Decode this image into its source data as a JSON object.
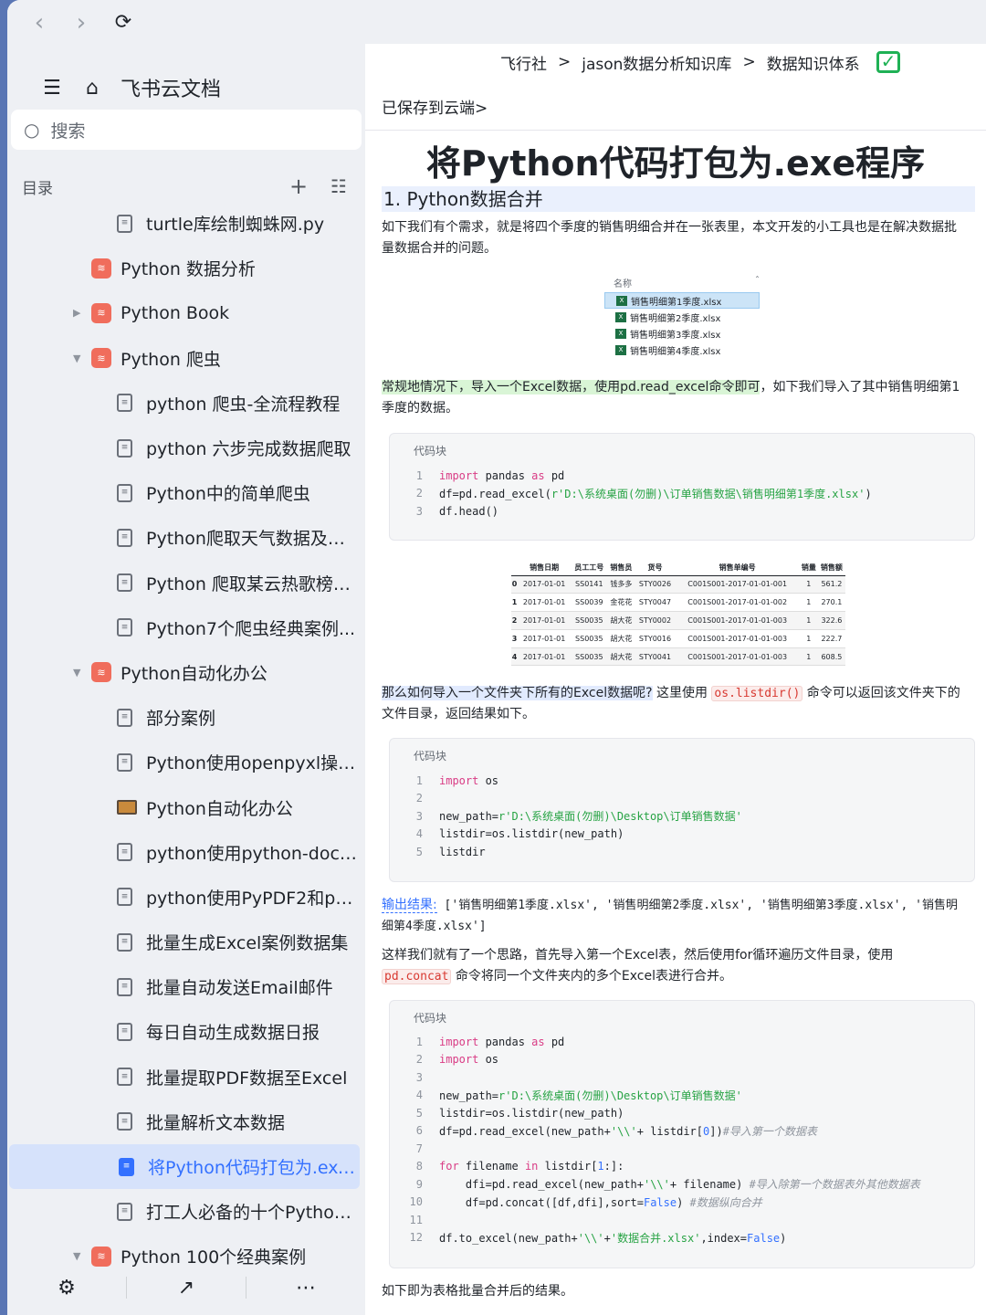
{
  "browser": {
    "back": "‹",
    "forward": "›",
    "reload": "⟳"
  },
  "sidebar": {
    "app_name": "飞书云文档",
    "search_placeholder": "搜索",
    "toc_label": "目录",
    "items": [
      {
        "label": "turtle库绘制蜘蛛网.py",
        "level": 2,
        "icon": "file-icon"
      },
      {
        "label": "Python 数据分析",
        "level": 1,
        "icon": "book-icon"
      },
      {
        "label": "Python Book",
        "level": 1,
        "icon": "book-icon",
        "arrow": "▶"
      },
      {
        "label": "Python 爬虫",
        "level": 1,
        "icon": "book-icon",
        "arrow": "▼"
      },
      {
        "label": "python 爬虫-全流程教程",
        "level": 2,
        "icon": "doc-icon"
      },
      {
        "label": "python 六步完成数据爬取",
        "level": 2,
        "icon": "doc-icon"
      },
      {
        "label": "Python中的简单爬虫",
        "level": 2,
        "icon": "doc-icon"
      },
      {
        "label": "Python爬取天气数据及可...",
        "level": 2,
        "icon": "doc-icon"
      },
      {
        "label": "Python 爬取某云热歌榜歌...",
        "level": 2,
        "icon": "doc-icon"
      },
      {
        "label": "Python7个爬虫经典案例...",
        "level": 2,
        "icon": "doc-icon"
      },
      {
        "label": "Python自动化办公",
        "level": 1,
        "icon": "book-icon",
        "arrow": "▼"
      },
      {
        "label": "部分案例",
        "level": 2,
        "icon": "doc-icon"
      },
      {
        "label": "Python使用openpyxl操作...",
        "level": 2,
        "icon": "doc-icon"
      },
      {
        "label": "Python自动化办公",
        "level": 2,
        "icon": "image-icon"
      },
      {
        "label": "python使用python-docx...",
        "level": 2,
        "icon": "doc-icon"
      },
      {
        "label": "python使用PyPDF2和pdfp...",
        "level": 2,
        "icon": "doc-icon"
      },
      {
        "label": "批量生成Excel案例数据集",
        "level": 2,
        "icon": "doc-icon"
      },
      {
        "label": "批量自动发送Email邮件",
        "level": 2,
        "icon": "doc-icon"
      },
      {
        "label": "每日自动生成数据日报",
        "level": 2,
        "icon": "doc-icon"
      },
      {
        "label": "批量提取PDF数据至Excel",
        "level": 2,
        "icon": "doc-icon"
      },
      {
        "label": "批量解析文本数据",
        "level": 2,
        "icon": "doc-icon"
      },
      {
        "label": "将Python代码打包为.exe...",
        "level": 2,
        "icon": "doc-icon",
        "active": true
      },
      {
        "label": "打工人必备的十个Python...",
        "level": 2,
        "icon": "doc-icon"
      },
      {
        "label": "Python 100个经典案例",
        "level": 1,
        "icon": "book-icon",
        "arrow": "▼"
      }
    ]
  },
  "breadcrumb": {
    "c1": "飞行社",
    "c2": "jason数据分析知识库",
    "c3": "数据知识体系",
    "sep": ">"
  },
  "doc": {
    "saved": "已保存到云端>",
    "title": "将Python代码打包为.exe程序",
    "h1": "1. Python数据合并",
    "p1": "如下我们有个需求，就是将四个季度的销售明细合并在一张表里，本文开发的小工具也是在解决数据批量数据合并的问题。",
    "files_header": "名称",
    "files": [
      "销售明细第1季度.xlsx",
      "销售明细第2季度.xlsx",
      "销售明细第3季度.xlsx",
      "销售明细第4季度.xlsx"
    ],
    "p2_hl": "常规地情况下，导入一个Excel数据，使用pd.read_excel命令即可",
    "p2_rest": "，如下我们导入了其中销售明细第1季度的数据。",
    "code_label": "代码块",
    "p3_hl": "那么如何导入一个文件夹下所有的Excel数据呢?",
    "p3_a": " 这里使用 ",
    "p3_code": "os.listdir()",
    "p3_b": " 命令可以返回该文件夹下的文件目录，返回结果如下。",
    "out_label": "输出结果:",
    "out_text": " ['销售明细第1季度.xlsx', '销售明细第2季度.xlsx', '销售明细第3季度.xlsx', '销售明细第4季度.xlsx']",
    "p4_a": "这样我们就有了一个思路，首先导入第一个Excel表，然后使用for循环遍历文件目录，使用",
    "p4_code": "pd.concat",
    "p4_b": " 命令将同一个文件夹内的多个Excel表进行合并。",
    "p5": "如下即为表格批量合并后的结果。"
  },
  "code1": [
    {
      "n": "1",
      "html": "<span class='kw'>import</span> pandas <span class='kw'>as</span> pd"
    },
    {
      "n": "2",
      "html": "df=pd.read_excel(<span class='st'>r'D:\\系统桌面(勿删)\\订单销售数据\\销售明细第1季度.xlsx'</span>)"
    },
    {
      "n": "3",
      "html": "df.head()"
    }
  ],
  "code2": [
    {
      "n": "1",
      "html": "<span class='kw'>import</span> os"
    },
    {
      "n": "2",
      "html": ""
    },
    {
      "n": "3",
      "html": "new_path=<span class='st'>r'D:\\系统桌面(勿删)\\Desktop\\订单销售数据'</span>"
    },
    {
      "n": "4",
      "html": "listdir=os.listdir(new_path)"
    },
    {
      "n": "5",
      "html": "listdir"
    }
  ],
  "code3": [
    {
      "n": "1",
      "html": "<span class='kw'>import</span> pandas <span class='kw'>as</span> pd"
    },
    {
      "n": "2",
      "html": "<span class='kw'>import</span> os"
    },
    {
      "n": "3",
      "html": ""
    },
    {
      "n": "4",
      "html": "new_path=<span class='st'>r'D:\\系统桌面(勿删)\\Desktop\\订单销售数据'</span>"
    },
    {
      "n": "5",
      "html": "listdir=os.listdir(new_path)"
    },
    {
      "n": "6",
      "html": "df=pd.read_excel(new_path+<span class='st'>'\\\\'</span>+ listdir[<span class='fl'>0</span>])<span class='cm'>#导入第一个数据表</span>"
    },
    {
      "n": "7",
      "html": ""
    },
    {
      "n": "8",
      "html": "<span class='kw'>for</span> filename <span class='kw'>in</span> listdir[<span class='fl'>1</span>:]:"
    },
    {
      "n": "9",
      "html": "    dfi=pd.read_excel(new_path+<span class='st'>'\\\\'</span>+ filename) <span class='cm'>#导入除第一个数据表外其他数据表</span>"
    },
    {
      "n": "10",
      "html": "    df=pd.concat([df,dfi],sort=<span class='fl'>False</span>) <span class='cm'>#数据纵向合并</span>"
    },
    {
      "n": "11",
      "html": ""
    },
    {
      "n": "12",
      "html": "df.to_excel(new_path+<span class='st'>'\\\\'</span>+<span class='st'>'数据合并.xlsx'</span>,index=<span class='fl'>False</span>)"
    }
  ],
  "table": {
    "headers": [
      "",
      "销售日期",
      "员工工号",
      "销售员",
      "货号",
      "销售单编号",
      "销量",
      "销售额"
    ],
    "rows": [
      [
        "0",
        "2017-01-01",
        "SS0141",
        "钱多多",
        "STY0026",
        "C001S001-2017-01-01-001",
        "1",
        "561.2"
      ],
      [
        "1",
        "2017-01-01",
        "SS0039",
        "金花花",
        "STY0047",
        "C001S001-2017-01-01-002",
        "1",
        "270.1"
      ],
      [
        "2",
        "2017-01-01",
        "SS0035",
        "胡大花",
        "STY0002",
        "C001S001-2017-01-01-003",
        "1",
        "322.6"
      ],
      [
        "3",
        "2017-01-01",
        "SS0035",
        "胡大花",
        "STY0016",
        "C001S001-2017-01-01-003",
        "1",
        "222.7"
      ],
      [
        "4",
        "2017-01-01",
        "SS0035",
        "胡大花",
        "STY0041",
        "C001S001-2017-01-01-003",
        "1",
        "608.5"
      ]
    ]
  }
}
